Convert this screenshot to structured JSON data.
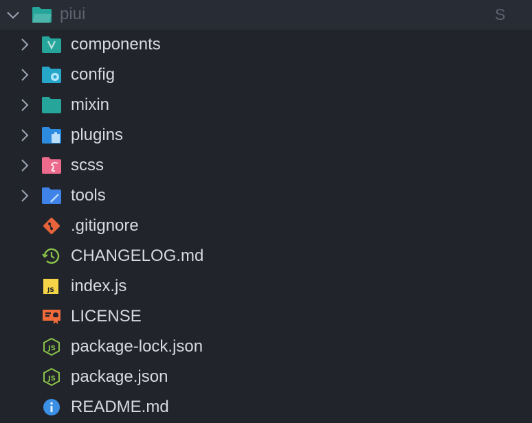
{
  "explorer": {
    "root": {
      "label": "piui",
      "status": "S",
      "expanded": true,
      "icon": "folder-open-icon"
    },
    "items": [
      {
        "label": "components",
        "type": "folder",
        "icon": "folder-vue-icon",
        "color": "#26a69a"
      },
      {
        "label": "config",
        "type": "folder",
        "icon": "folder-config-icon",
        "color": "#26a6c9"
      },
      {
        "label": "mixin",
        "type": "folder",
        "icon": "folder-icon",
        "color": "#26a69a"
      },
      {
        "label": "plugins",
        "type": "folder",
        "icon": "folder-plugin-icon",
        "color": "#2d8be0"
      },
      {
        "label": "scss",
        "type": "folder",
        "icon": "folder-sass-icon",
        "color": "#ec6a8c"
      },
      {
        "label": "tools",
        "type": "folder",
        "icon": "folder-tools-icon",
        "color": "#3f82e8"
      },
      {
        "label": ".gitignore",
        "type": "file",
        "icon": "git-icon",
        "color": "#e8633a"
      },
      {
        "label": "CHANGELOG.md",
        "type": "file",
        "icon": "changelog-icon",
        "color": "#8bc34a"
      },
      {
        "label": "index.js",
        "type": "file",
        "icon": "javascript-icon",
        "color": "#f5d547"
      },
      {
        "label": "LICENSE",
        "type": "file",
        "icon": "license-icon",
        "color": "#f06a3a"
      },
      {
        "label": "package-lock.json",
        "type": "file",
        "icon": "nodejs-icon",
        "color": "#8bc34a"
      },
      {
        "label": "package.json",
        "type": "file",
        "icon": "nodejs-icon",
        "color": "#8bc34a"
      },
      {
        "label": "README.md",
        "type": "file",
        "icon": "info-icon",
        "color": "#3b8fe5"
      }
    ]
  }
}
